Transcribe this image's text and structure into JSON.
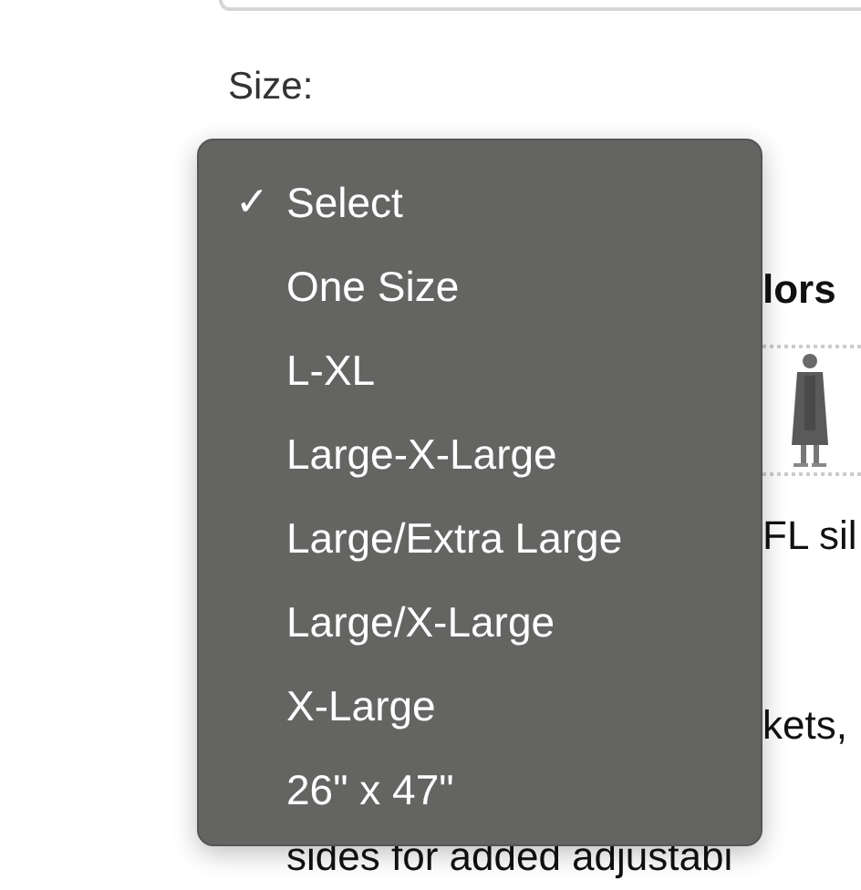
{
  "size_label": "Size:",
  "dropdown": {
    "check_mark": "✓",
    "options": [
      {
        "label": "Select",
        "selected": true
      },
      {
        "label": "One Size",
        "selected": false
      },
      {
        "label": "L-XL",
        "selected": false
      },
      {
        "label": "Large-X-Large",
        "selected": false
      },
      {
        "label": "Large/Extra Large",
        "selected": false
      },
      {
        "label": "Large/X-Large",
        "selected": false
      },
      {
        "label": "X-Large",
        "selected": false
      },
      {
        "label": "26\" x 47\"",
        "selected": false
      }
    ]
  },
  "background": {
    "heading": "lors",
    "line_1": "FL sil",
    "line_2": "kets,",
    "line_3": "sides for added adjustabi"
  }
}
